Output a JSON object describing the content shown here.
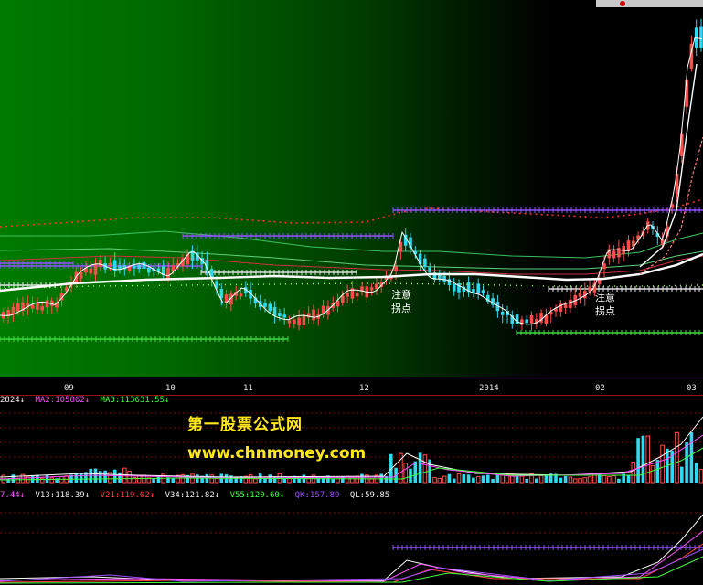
{
  "chart_data": {
    "type": "candlestick",
    "date_labels": [
      "09",
      "10",
      "11",
      "12",
      "2014",
      "02",
      "03"
    ],
    "annotations": [
      {
        "line1": "注意",
        "line2": "拐点"
      },
      {
        "line1": "注意",
        "line2": "拐点"
      }
    ],
    "volume_legend": [
      {
        "text": "2824↓",
        "color": "#f0f0f0"
      },
      {
        "text": "MA2:105862↓",
        "color": "#ff50ff"
      },
      {
        "text": "MA3:113631.55↓",
        "color": "#40ff40"
      }
    ],
    "indicator_legend": [
      {
        "text": "7.44↓",
        "color": "#ff50ff"
      },
      {
        "text": "V13:118.39↓",
        "color": "#f0f0f0"
      },
      {
        "text": "V21:119.02↓",
        "color": "#ff4040"
      },
      {
        "text": "V34:121.82↓",
        "color": "#f0f0f0"
      },
      {
        "text": "V55:120.60↓",
        "color": "#40ff40"
      },
      {
        "text": "QK:157.89",
        "color": "#a050ff"
      },
      {
        "text": "QL:59.85",
        "color": "#f0f0f0"
      }
    ],
    "colors": {
      "up": "#ff4d4d",
      "down": "#30d8f0",
      "ma_fast": "#ffffff",
      "ma_band": "#ff3030",
      "level": "#9050ff",
      "support": "#40d840"
    }
  },
  "watermark": {
    "title": "第一股票公式网",
    "url": "www.chnmoney.com"
  }
}
